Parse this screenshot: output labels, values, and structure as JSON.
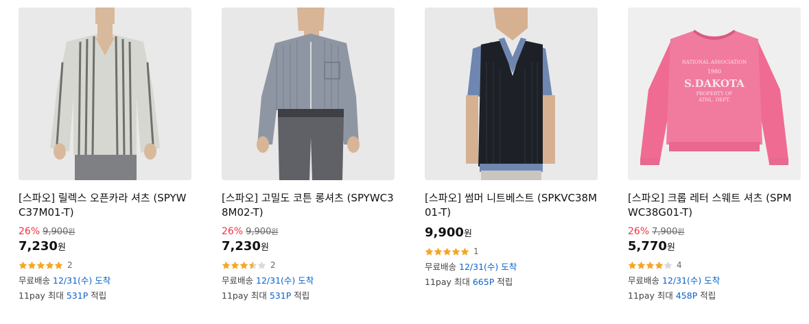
{
  "products": [
    {
      "title": "[스파오] 릴렉스 오픈카라 셔츠 (SPYWC37M01-T)",
      "discount": "26%",
      "original_price": "9,900",
      "original_unit": "원",
      "price": "7,230",
      "price_unit": "원",
      "rating": 5,
      "review_count": "2",
      "shipping_label": "무료배송",
      "shipping_date": "12/31(수) 도착",
      "pay_label": "11pay 최대",
      "pay_points": "531P",
      "pay_suffix": "적립",
      "image": "striped-shirt-man"
    },
    {
      "title": "[스파오] 고밀도 코튼 롱셔츠 (SPYWC38M02-T)",
      "discount": "26%",
      "original_price": "9,900",
      "original_unit": "원",
      "price": "7,230",
      "price_unit": "원",
      "rating": 3.5,
      "review_count": "2",
      "shipping_label": "무료배송",
      "shipping_date": "12/31(수) 도착",
      "pay_label": "11pay 최대",
      "pay_points": "531P",
      "pay_suffix": "적립",
      "image": "check-shirt-man"
    },
    {
      "title": "[스파오] 썸머 니트베스트 (SPKVC38M01-T)",
      "price": "9,900",
      "price_unit": "원",
      "rating": 5,
      "review_count": "1",
      "shipping_label": "무료배송",
      "shipping_date": "12/31(수) 도착",
      "pay_label": "11pay 최대",
      "pay_points": "665P",
      "pay_suffix": "적립",
      "image": "knit-vest-man"
    },
    {
      "title": "[스파오] 크롭 레터 스웨트 셔츠 (SPMWC38G01-T)",
      "discount": "26%",
      "original_price": "7,900",
      "original_unit": "원",
      "price": "5,770",
      "price_unit": "원",
      "rating": 4,
      "review_count": "4",
      "shipping_label": "무료배송",
      "shipping_date": "12/31(수) 도착",
      "pay_label": "11pay 최대",
      "pay_points": "458P",
      "pay_suffix": "적립",
      "image": "pink-sweatshirt",
      "print_text": [
        "NATIONAL ASSOCIATION",
        "1980",
        "S.DAKOTA",
        "PROPERTY OF",
        "ATHL. DEPT."
      ]
    }
  ],
  "colors": {
    "discount": "#f43142",
    "link": "#0a62c9",
    "star": "#f5a623",
    "star_empty": "#d8d8d8"
  }
}
